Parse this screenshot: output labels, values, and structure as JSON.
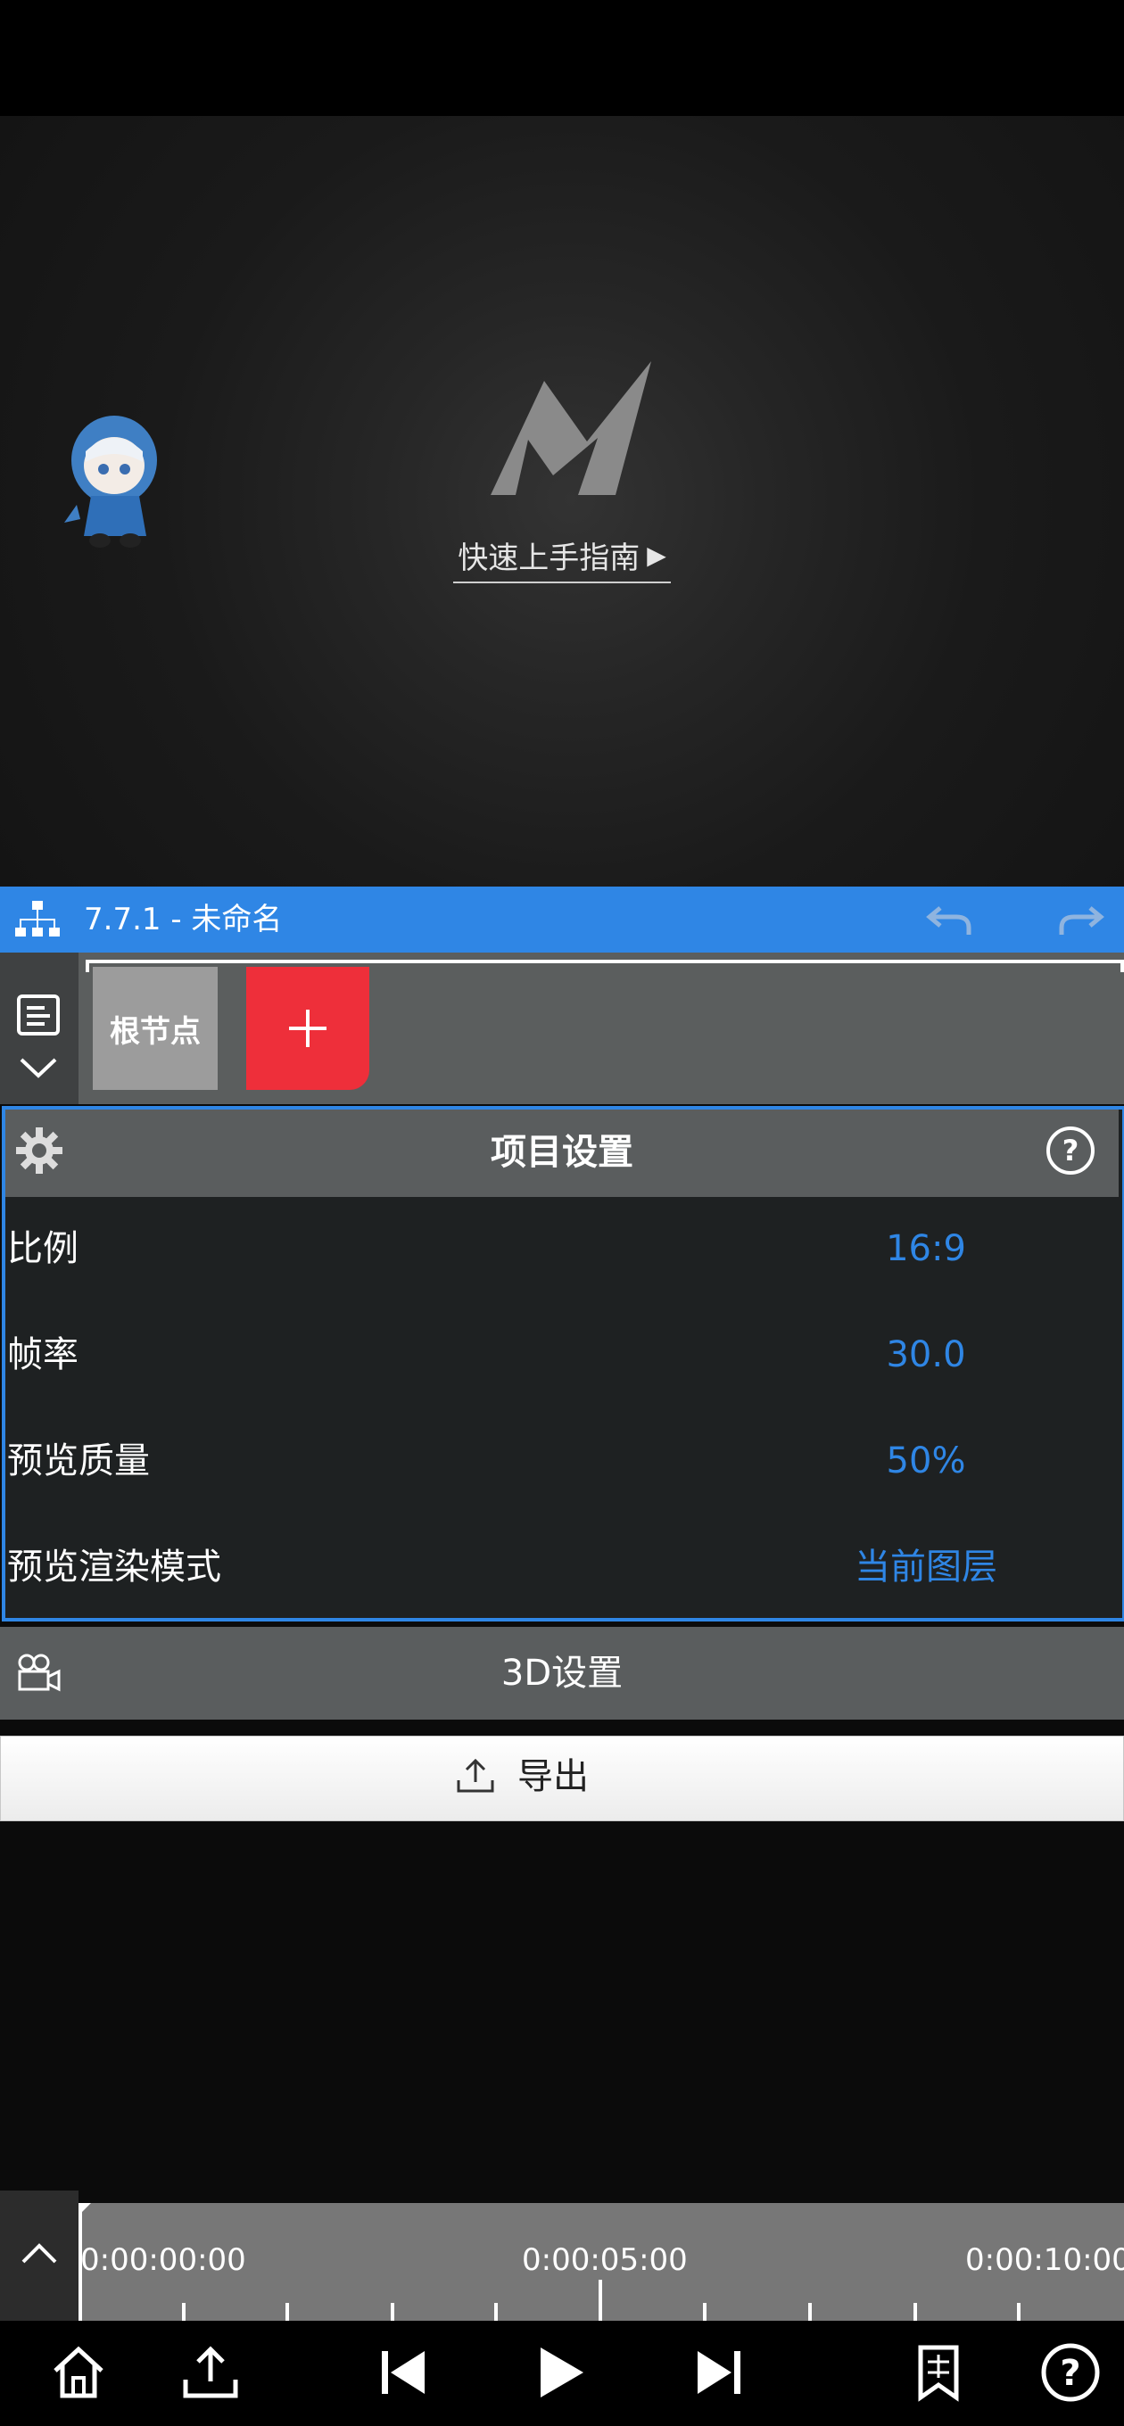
{
  "preview": {
    "guide_label": "快速上手指南"
  },
  "project_bar": {
    "title": "7.7.1 - 未命名"
  },
  "layers": {
    "root_node_label": "根节点"
  },
  "settings": {
    "title": "项目设置",
    "rows": [
      {
        "label": "比例",
        "value": "16:9"
      },
      {
        "label": "帧率",
        "value": "30.0"
      },
      {
        "label": "预览质量",
        "value": "50%"
      },
      {
        "label": "预览渲染模式",
        "value": "当前图层"
      }
    ]
  },
  "three_d": {
    "label": "3D设置"
  },
  "export": {
    "label": "导出"
  },
  "timeline": {
    "labels": [
      "0:00:00:00",
      "0:00:05:00",
      "0:00:10:00"
    ]
  },
  "colors": {
    "accent_blue": "#2f86e5",
    "add_red": "#ee2f3a",
    "panel_gray": "#5a5d5e"
  },
  "icons": {
    "top_bar": [
      "hierarchy-icon",
      "undo-icon",
      "redo-icon"
    ],
    "bottom_bar": [
      "home-icon",
      "share-icon",
      "skip-back-icon",
      "play-icon",
      "skip-forward-icon",
      "bookmark-icon",
      "help-icon"
    ]
  }
}
